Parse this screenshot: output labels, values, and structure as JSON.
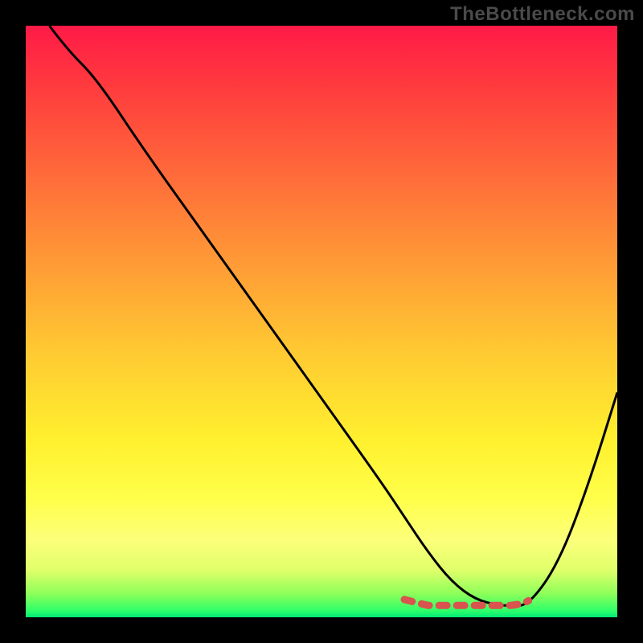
{
  "watermark": "TheBottleneck.com",
  "chart_data": {
    "type": "line",
    "title": "",
    "xlabel": "",
    "ylabel": "",
    "xlim": [
      0,
      100
    ],
    "ylim": [
      0,
      100
    ],
    "series": [
      {
        "name": "bottleneck-curve",
        "color": "#000000",
        "x": [
          4,
          7,
          12,
          20,
          30,
          40,
          50,
          60,
          64,
          68,
          72,
          76,
          80,
          82,
          85,
          90,
          95,
          100
        ],
        "values": [
          100,
          96,
          91,
          79,
          65,
          51,
          37,
          23,
          17,
          11,
          6,
          3,
          2,
          2,
          2,
          9,
          22,
          38
        ]
      },
      {
        "name": "optimal-marker",
        "color": "#d9534f",
        "x": [
          64,
          66,
          68,
          70,
          72,
          74,
          76,
          78,
          80,
          82,
          84,
          85
        ],
        "values": [
          3,
          2.5,
          2,
          2,
          2,
          2,
          2,
          2,
          2,
          2,
          2.3,
          2.8
        ]
      }
    ],
    "color_scale_note": "vertical axis maps to spectrum: red (high bottleneck) at top through orange, yellow to green (optimal) at bottom"
  }
}
